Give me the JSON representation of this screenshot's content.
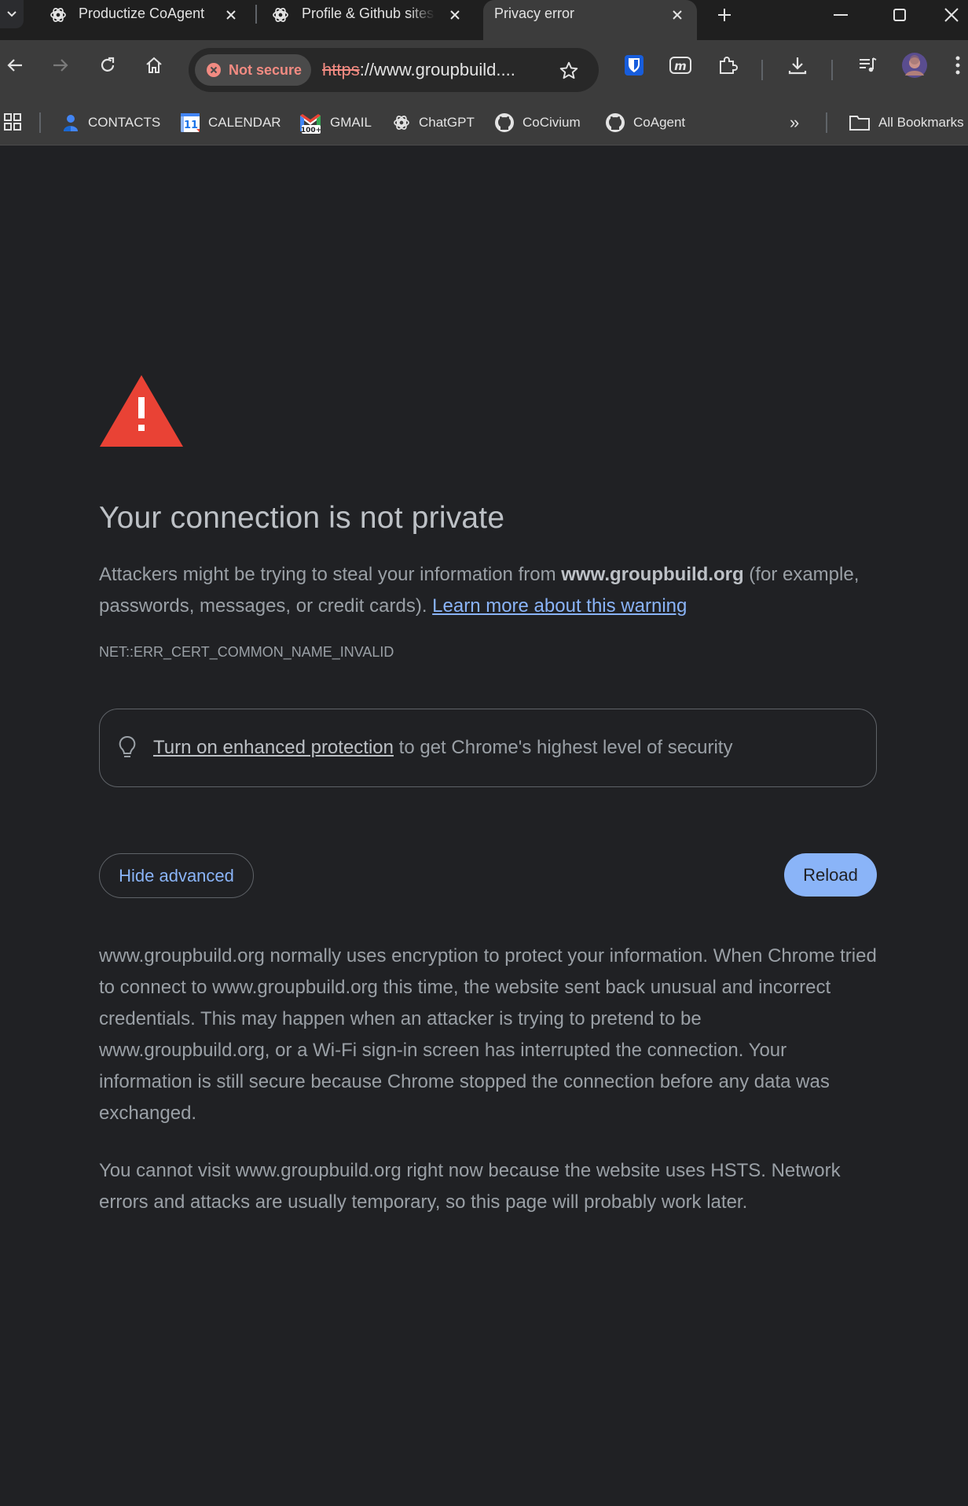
{
  "tabs": [
    {
      "title": "Productize CoAgent",
      "icon": "openai-icon"
    },
    {
      "title": "Profile & Github sites",
      "icon": "openai-icon"
    },
    {
      "title": "Privacy error",
      "icon": "none",
      "active": true
    }
  ],
  "toolbar": {
    "security_chip": "Not secure",
    "url_scheme": "https",
    "url_rest": "://www.groupbuild...."
  },
  "bookmarks": [
    {
      "label": "CONTACTS",
      "icon": "contacts-icon"
    },
    {
      "label": "CALENDAR",
      "icon": "calendar-icon",
      "badge": "11"
    },
    {
      "label": "GMAIL",
      "icon": "gmail-icon",
      "badge": "100+"
    },
    {
      "label": "ChatGPT",
      "icon": "openai-icon"
    },
    {
      "label": "CoCivium",
      "icon": "github-icon"
    },
    {
      "label": "CoAgent",
      "icon": "github-icon"
    }
  ],
  "bookmarks_overflow": "»",
  "all_bookmarks": "All Bookmarks",
  "page": {
    "heading": "Your connection is not private",
    "para1_pre": "Attackers might be trying to steal your information from ",
    "para1_domain": "www.groupbuild.org",
    "para1_post": " (for example, passwords, messages, or credit cards). ",
    "learn_more": "Learn more about this warning",
    "error_code": "NET::ERR_CERT_COMMON_NAME_INVALID",
    "enhanced_link": "Turn on enhanced protection",
    "enhanced_rest": " to get Chrome's highest level of security",
    "hide_advanced": "Hide advanced",
    "reload": "Reload",
    "advanced_para1": "www.groupbuild.org normally uses encryption to protect your information. When Chrome tried to connect to www.groupbuild.org this time, the website sent back unusual and incorrect credentials. This may happen when an attacker is trying to pretend to be www.groupbuild.org, or a Wi-Fi sign-in screen has interrupted the connection. Your information is still secure because Chrome stopped the connection before any data was exchanged.",
    "advanced_para2": "You cannot visit www.groupbuild.org right now because the website uses HSTS. Network errors and attacks are usually temporary, so this page will probably work later."
  },
  "colors": {
    "background": "#202124",
    "warning_red": "#e94235",
    "link_blue": "#8ab4f8",
    "not_secure_red": "#f28b82"
  }
}
